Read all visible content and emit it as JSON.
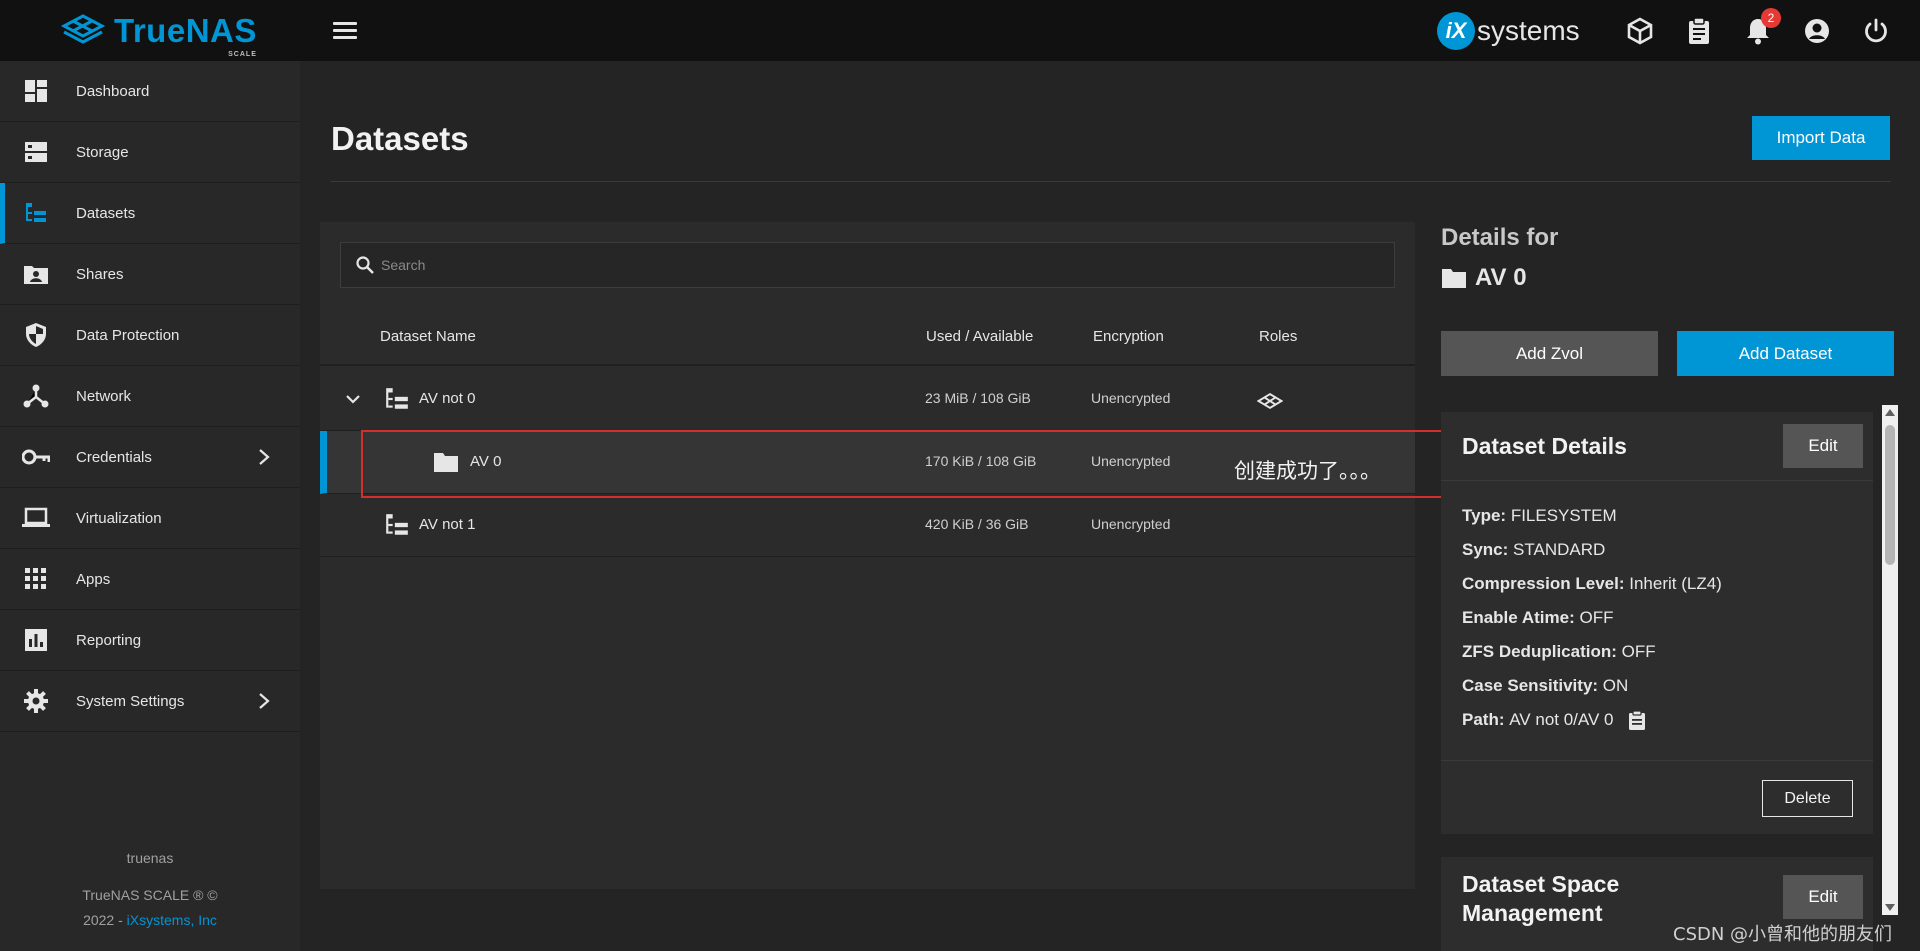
{
  "app": {
    "brand": "TrueNAS",
    "brand_sub": "SCALE",
    "vendor_logo": "systems"
  },
  "topbar": {
    "notification_count": "2"
  },
  "sidebar": {
    "items": [
      {
        "label": "Dashboard",
        "icon": "dashboard-icon"
      },
      {
        "label": "Storage",
        "icon": "storage-icon"
      },
      {
        "label": "Datasets",
        "icon": "datasets-icon",
        "active": true
      },
      {
        "label": "Shares",
        "icon": "shares-icon"
      },
      {
        "label": "Data Protection",
        "icon": "shield-icon"
      },
      {
        "label": "Network",
        "icon": "network-icon"
      },
      {
        "label": "Credentials",
        "icon": "key-icon",
        "has_submenu": true
      },
      {
        "label": "Virtualization",
        "icon": "laptop-icon"
      },
      {
        "label": "Apps",
        "icon": "apps-grid-icon"
      },
      {
        "label": "Reporting",
        "icon": "reporting-icon"
      },
      {
        "label": "System Settings",
        "icon": "gear-icon",
        "has_submenu": true
      }
    ],
    "hostname": "truenas",
    "copyright_line1": "TrueNAS SCALE ® ©",
    "copyright_year": "2022 -",
    "copyright_company": "iXsystems, Inc"
  },
  "main": {
    "title": "Datasets",
    "import_button": "Import Data",
    "search_placeholder": "Search",
    "columns": {
      "name": "Dataset Name",
      "used": "Used / Available",
      "encryption": "Encryption",
      "roles": "Roles"
    },
    "rows": [
      {
        "name": "AV not 0",
        "used": "23 MiB / 108 GiB",
        "encryption": "Unencrypted",
        "type": "root"
      },
      {
        "name": "AV 0",
        "used": "170 KiB / 108 GiB",
        "encryption": "Unencrypted",
        "type": "child"
      },
      {
        "name": "AV not 1",
        "used": "420 KiB / 36 GiB",
        "encryption": "Unencrypted",
        "type": "root"
      }
    ],
    "annotation": "创建成功了。。。"
  },
  "details": {
    "header": "Details for",
    "name": "AV 0",
    "add_zvol": "Add Zvol",
    "add_dataset": "Add Dataset",
    "card_title": "Dataset Details",
    "edit_label": "Edit",
    "properties": [
      {
        "key": "Type:",
        "value": "FILESYSTEM"
      },
      {
        "key": "Sync:",
        "value": "STANDARD"
      },
      {
        "key": "Compression Level:",
        "value": "Inherit (LZ4)"
      },
      {
        "key": "Enable Atime:",
        "value": "OFF"
      },
      {
        "key": "ZFS Deduplication:",
        "value": "OFF"
      },
      {
        "key": "Case Sensitivity:",
        "value": "ON"
      },
      {
        "key": "Path:",
        "value": "AV not 0/AV 0"
      }
    ],
    "delete_label": "Delete",
    "space_title": "Dataset Space Management",
    "space_edit": "Edit"
  },
  "watermark": "CSDN @小曾和他的朋友们",
  "colors": {
    "accent": "#0095d5",
    "annotation": "#d32f2f",
    "badge": "#e53935"
  }
}
